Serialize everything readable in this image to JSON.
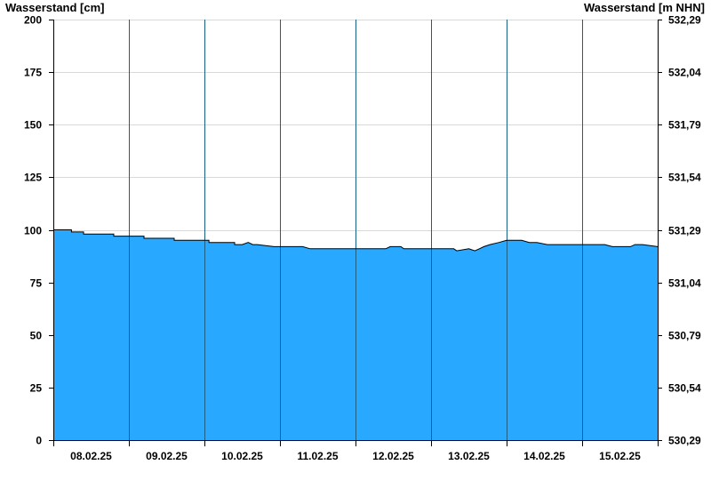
{
  "chart_data": {
    "type": "area",
    "ylabel": "Wasserstand [cm]",
    "ylabel_right": "Wasserstand [m NHN]",
    "ylim": [
      0,
      200
    ],
    "yticks": [
      0,
      25,
      50,
      75,
      100,
      125,
      150,
      175,
      200
    ],
    "yticks_right": [
      "530,29",
      "530,54",
      "530,79",
      "531,04",
      "531,29",
      "531,54",
      "531,79",
      "532,04",
      "532,29"
    ],
    "xlim": [
      0,
      8
    ],
    "day_labels": [
      "08.02.25",
      "09.02.25",
      "10.02.25",
      "11.02.25",
      "12.02.25",
      "13.02.25",
      "14.02.25",
      "15.02.25"
    ],
    "grid": true,
    "fill_color": "#29a8ff",
    "line_color": "#000000",
    "series": [
      {
        "x": [
          0.0,
          0.24,
          0.24,
          0.4,
          0.4,
          0.8,
          0.8,
          1.2,
          1.2,
          1.6,
          1.6,
          2.06,
          2.06,
          2.4,
          2.4,
          2.5,
          2.58,
          2.64,
          2.7,
          2.92,
          3.0,
          3.1,
          3.2,
          3.3,
          3.4,
          3.5,
          3.6,
          3.7,
          3.8,
          4.0,
          4.2,
          4.4,
          4.46,
          4.6,
          4.64,
          4.8,
          5.0,
          5.2,
          5.24,
          5.3,
          5.34,
          5.5,
          5.58,
          5.64,
          5.7,
          5.78,
          5.9,
          6.0,
          6.1,
          6.2,
          6.3,
          6.4,
          6.54,
          6.56,
          6.7,
          6.8,
          7.0,
          7.1,
          7.16,
          7.3,
          7.4,
          7.5,
          7.56,
          7.64,
          7.7,
          7.8,
          8.0
        ],
        "y": [
          100,
          100,
          99,
          99,
          98,
          98,
          97,
          97,
          96,
          96,
          95,
          95,
          94,
          94,
          93,
          93,
          94,
          93,
          93,
          92,
          92,
          92,
          92,
          92,
          91,
          91,
          91,
          91,
          91,
          91,
          91,
          91,
          92,
          92,
          91,
          91,
          91,
          91,
          91,
          91,
          90,
          91,
          90,
          91,
          92,
          93,
          94,
          95,
          95,
          95,
          94,
          94,
          93,
          93,
          93,
          93,
          93,
          93,
          93,
          93,
          92,
          92,
          92,
          92,
          93,
          93,
          92
        ]
      }
    ]
  }
}
